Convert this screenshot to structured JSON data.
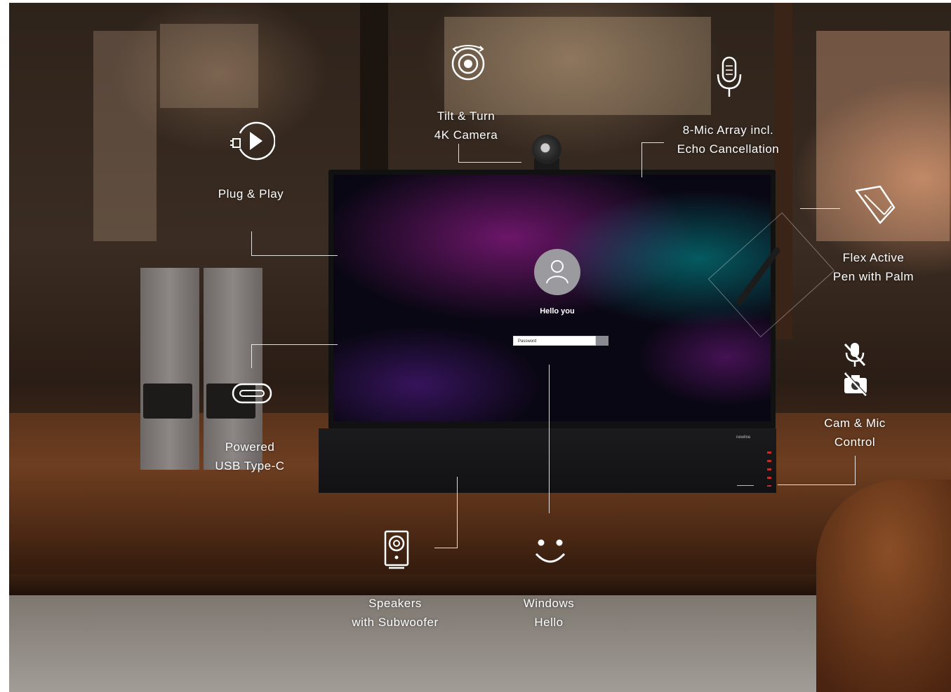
{
  "features": {
    "camera": "Tilt & Turn\n4K Camera",
    "mic": "8-Mic Array incl.\nEcho Cancellation",
    "plug": "Plug & Play",
    "pen": "Flex Active\nPen with Palm",
    "usb": "Powered\nUSB Type-C",
    "cam_mic_control": "Cam & Mic\nControl",
    "speakers": "Speakers\nwith Subwoofer",
    "hello": "Windows\nHello"
  },
  "screen": {
    "greeting": "Hello you",
    "password_placeholder": "Password"
  },
  "device": {
    "brand": "newline"
  },
  "icons": [
    "rotating-camera-icon",
    "microphone-icon",
    "plug-play-icon",
    "pen-icon",
    "mic-muted-icon",
    "camera-muted-icon",
    "usb-c-icon",
    "speaker-icon",
    "smiley-face-icon",
    "user-avatar-icon"
  ],
  "colors": {
    "label_text": "#ffffff",
    "leader_line": "#ffffff"
  }
}
